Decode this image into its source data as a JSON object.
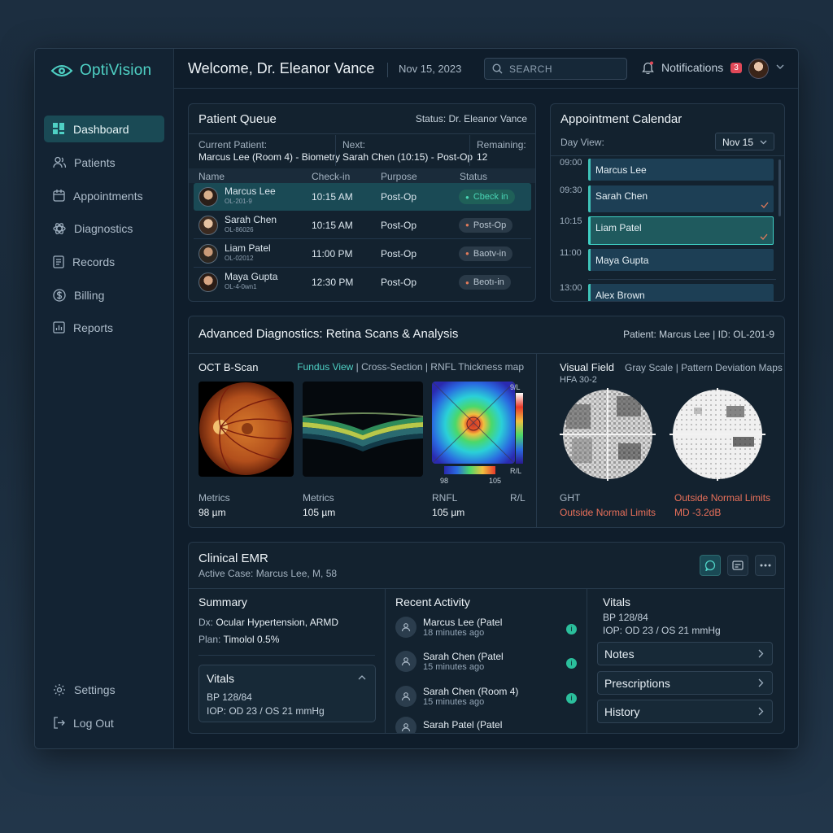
{
  "app": {
    "name": "OptiVision"
  },
  "sidebar": {
    "items": [
      {
        "label": "Dashboard",
        "icon": "dashboard-icon"
      },
      {
        "label": "Patients",
        "icon": "users-icon"
      },
      {
        "label": "Appointments",
        "icon": "calendar-icon"
      },
      {
        "label": "Diagnostics",
        "icon": "atom-icon"
      },
      {
        "label": "Records",
        "icon": "file-icon"
      },
      {
        "label": "Billing",
        "icon": "dollar-icon"
      },
      {
        "label": "Reports",
        "icon": "chart-icon"
      }
    ],
    "bottom": [
      {
        "label": "Settings",
        "icon": "gear-icon"
      },
      {
        "label": "Log Out",
        "icon": "logout-icon"
      }
    ]
  },
  "header": {
    "welcome": "Welcome, Dr. Eleanor Vance",
    "date": "Nov 15, 2023",
    "search_placeholder": "SEARCH",
    "notifications_label": "Notifications",
    "notifications_count": "3"
  },
  "queue": {
    "title": "Patient Queue",
    "status": "Status: Dr. Eleanor Vance",
    "current_label": "Current Patient:",
    "current_value": "Marcus Lee (Room 4) - Biometry",
    "next_label": "Next:",
    "next_value": "Sarah Chen (10:15) - Post-Op",
    "remaining_label": "Remaining:",
    "remaining_value": "12",
    "columns": [
      "Name",
      "Check-in",
      "Purpose",
      "Status"
    ],
    "rows": [
      {
        "name": "Marcus Lee",
        "id": "OL-201-9",
        "checkin": "10:15 AM",
        "purpose": "Post-Op",
        "status": "Cbeck in"
      },
      {
        "name": "Sarah Chen",
        "id": "OL-86026",
        "checkin": "10:15 AM",
        "purpose": "Post-Op",
        "status": "Post-Op"
      },
      {
        "name": "Liam Patel",
        "id": "OL-02012",
        "checkin": "11:00 PM",
        "purpose": "Post-Op",
        "status": "Baotv-in"
      },
      {
        "name": "Maya Gupta",
        "id": "OL-4-0wn1",
        "checkin": "12:30 PM",
        "purpose": "Post-Op",
        "status": "Beotı-in"
      }
    ]
  },
  "calendar": {
    "title": "Appointment Calendar",
    "day_view_label": "Day View:",
    "day_select": "Nov 15",
    "slots": [
      {
        "time": "09:00",
        "name": "Marcus Lee"
      },
      {
        "time": "09:30",
        "name": "Sarah Chen"
      },
      {
        "time": "10:15",
        "name": "Liam Patel"
      },
      {
        "time": "11:00",
        "name": "Maya Gupta"
      },
      {
        "time": "13:00",
        "name": "Alex Brown"
      }
    ]
  },
  "diagnostics": {
    "title": "Advanced Diagnostics: Retina Scans & Analysis",
    "patient": "Patient: Marcus Lee | ID: OL-201-9",
    "oct_title": "OCT B-Scan",
    "views": {
      "fundus": "Fundus View",
      "cross": "Cross-Section",
      "rnfl": "RNFL Thickness map"
    },
    "colorbar_top": "9/L",
    "colorbar_bottom": "R/L",
    "scale_min": "98",
    "scale_max": "105",
    "metrics": [
      {
        "label": "Metrics",
        "value": "98 µm"
      },
      {
        "label": "Metrics",
        "value": "105 µm"
      },
      {
        "label": "RNFL",
        "value": "105 µm"
      },
      {
        "label": "R/L",
        "value": ""
      }
    ],
    "vf_title": "Visual Field",
    "vf_maps": "Gray Scale | Pattern Deviation Maps",
    "vf_sub": "HFA 30-2",
    "ght_label": "GHT",
    "ght_value": "Outside Normal Limits",
    "pd_label": "Outside Normal Limits",
    "pd_value": "MD -3.2dB"
  },
  "emr": {
    "title": "Clinical EMR",
    "case": "Active Case: Marcus Lee, M, 58",
    "summary_title": "Summary",
    "dx_label": "Dx:",
    "dx_value": "Ocular Hypertension, ARMD",
    "plan_label": "Plan:",
    "plan_value": "Timolol 0.5%",
    "vitals_title": "Vitals",
    "bp": "BP 128/84",
    "iop": "IOP: OD 23 / OS 21 mmHg",
    "activity_title": "Recent Activity",
    "activity": [
      {
        "name": "Marcus Lee (Patel",
        "time": "18 minutes ago"
      },
      {
        "name": "Sarah Chen (Patel",
        "time": "15 minutes ago"
      },
      {
        "name": "Sarah Chen (Room 4)",
        "time": "15 minutes ago"
      },
      {
        "name": "Sarah Patel (Patel",
        "time": ""
      }
    ],
    "right_vitals_title": "Vitals",
    "right_bp": "BP 128/84",
    "right_iop": "IOP: OD 23 / OS 21 mmHg",
    "links": [
      "Notes",
      "Prescriptions",
      "History"
    ]
  }
}
